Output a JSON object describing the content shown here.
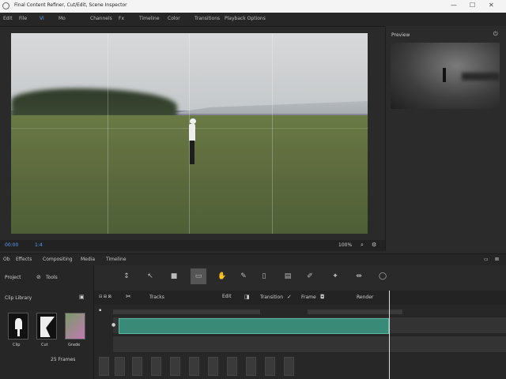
{
  "titlebar": {
    "title": "Final Content Refiner, Cut/Edit, Scene Inspector",
    "controls": [
      "—",
      "☐",
      "✕"
    ]
  },
  "menubar": {
    "items": [
      "Edit",
      "File",
      "Vi",
      "Mo",
      "Channels",
      "Fx",
      "Timeline",
      "Color",
      "Transitions",
      "Playback Options"
    ]
  },
  "viewer": {
    "timecode_left": "00:00",
    "timecode_mid": "1:4",
    "zoom": "100%"
  },
  "right_panel": {
    "title": "Preview"
  },
  "tabs": [
    "Ob",
    "Effects",
    "Compositing",
    "Media",
    "Timeline"
  ],
  "left_panel": {
    "header_label": "Project",
    "header_value": "Tools",
    "section_title": "Clip Library",
    "swatch_labels": [
      "Clip",
      "Cut",
      "Grade"
    ],
    "footer": "25 Frames"
  },
  "timeline_head": {
    "label_a": "Tracks",
    "label_b": "Edit",
    "label_c": "Transition",
    "label_d": "Frame",
    "label_e": "Render"
  },
  "colors": {
    "accent": "#5aa0ff",
    "clip": "#3a8a78",
    "bg": "#2a2a2a"
  }
}
